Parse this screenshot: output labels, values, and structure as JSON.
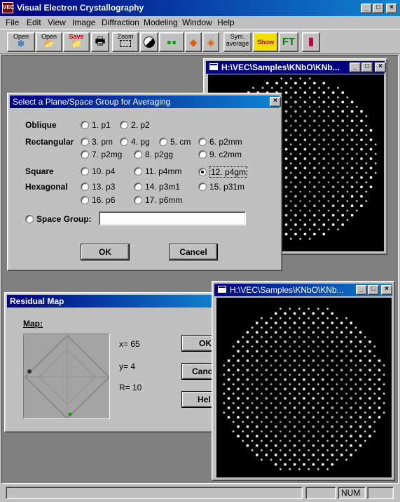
{
  "app": {
    "title": "Visual Electron Crystallography",
    "icon_text": "VEC"
  },
  "menu": [
    "File",
    "Edit",
    "View",
    "Image",
    "Diffraction",
    "Modeling",
    "Window",
    "Help"
  ],
  "toolbar": {
    "open_diff_label": "Open",
    "open_image_label": "Open",
    "save_label": "Save",
    "zoom_label": "Zoom",
    "sym_average_label": "Sym. average",
    "sym_show_label": "Show",
    "ft_label": "FT"
  },
  "window_back": {
    "title": "H:\\VEC\\Samples\\KNbO\\KNb..."
  },
  "window_front": {
    "title": "H:\\VEC\\Samples\\KNbO\\KNb..."
  },
  "plane_dialog": {
    "title": "Select a Plane/Space Group for Averaging",
    "rows": {
      "oblique": "Oblique",
      "rectangular": "Rectangular",
      "square": "Square",
      "hexagonal": "Hexagonal"
    },
    "options": {
      "p1": "1. p1",
      "p2": "2. p2",
      "pm": "3. pm",
      "pg": "4. pg",
      "cm": "5. cm",
      "p2mm": "6. p2mm",
      "p2mg": "7. p2mg",
      "p2gg": "8. p2gg",
      "c2mm": "9. c2mm",
      "p4": "10. p4",
      "p4mm": "11. p4mm",
      "p4gm": "12. p4gm",
      "p3": "13. p3",
      "p3m1": "14. p3m1",
      "p31m": "15. p31m",
      "p6": "16. p6",
      "p6mm": "17. p6mm"
    },
    "selected": "p4gm",
    "space_group_label": "Space Group:",
    "space_group_value": "",
    "ok_label": "OK",
    "cancel_label": "Cancel"
  },
  "residual_dialog": {
    "title": "Residual Map",
    "map_label": "Map:",
    "x_text": "x= 65",
    "y_text": "y= 4",
    "r_text": "R= 10",
    "ok_label": "OK",
    "cancel_label": "Canc",
    "help_label": "Hel"
  },
  "status": {
    "num": "NUM"
  }
}
